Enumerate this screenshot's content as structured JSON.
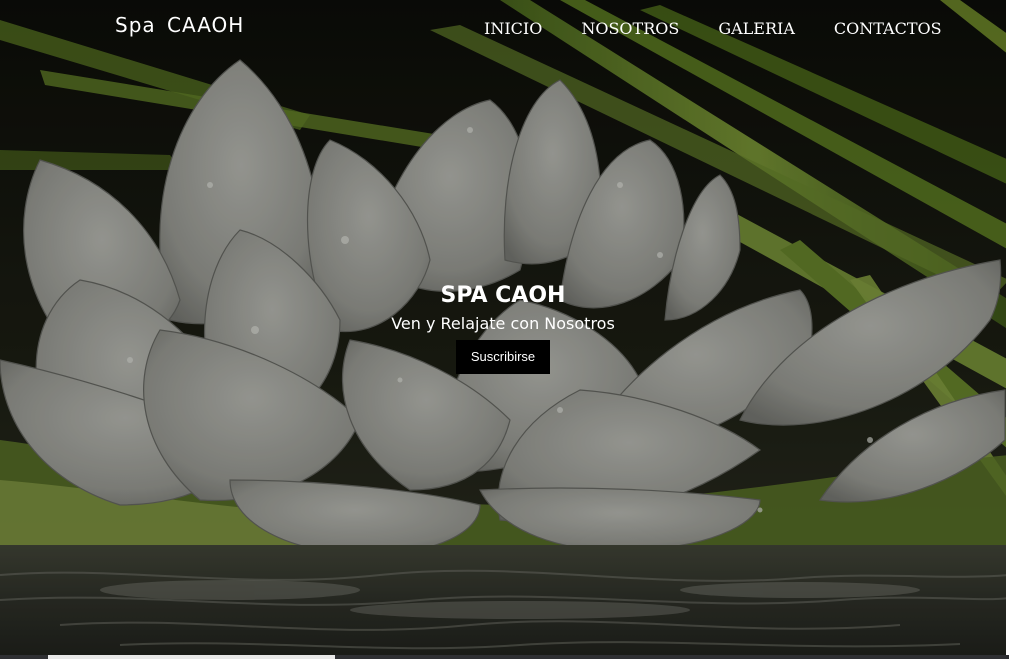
{
  "navbar": {
    "brand": "Spa  CAAOH",
    "links": [
      {
        "label": "INICIO"
      },
      {
        "label": "NOSOTROS"
      },
      {
        "label": "GALERIA"
      },
      {
        "label": "CONTACTOS"
      }
    ]
  },
  "hero": {
    "title": "SPA CAOH",
    "subtitle": "Ven y Relajate con Nosotros",
    "button_label": "Suscribirse",
    "background_image": "lotus-flower-on-water-photo"
  },
  "colors": {
    "button_bg": "#000000",
    "text": "#ffffff",
    "foliage": "#6f8a2a"
  }
}
